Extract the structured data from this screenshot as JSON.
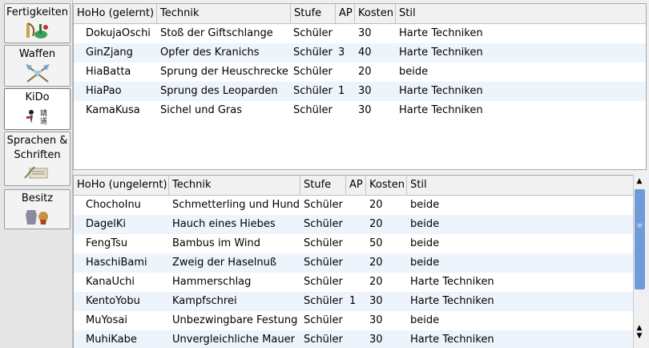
{
  "sidebar": {
    "tabs": [
      {
        "label": "Fertigkeiten",
        "icon": "instruments-icon",
        "active": false
      },
      {
        "label": "Waffen",
        "icon": "crossed-axes-icon",
        "active": false
      },
      {
        "label": "KiDo",
        "icon": "kido-scroll-icon",
        "active": true
      },
      {
        "label": "Sprachen & Schriften",
        "icon": "scroll-quill-icon",
        "active": false
      },
      {
        "label": "Besitz",
        "icon": "armor-icon",
        "active": false
      }
    ]
  },
  "learned": {
    "columns": [
      "HoHo (gelernt)",
      "Technik",
      "Stufe",
      "AP",
      "Kosten",
      "Stil"
    ],
    "rows": [
      [
        "DokujaOschi",
        "Stoß der Giftschlange",
        "Schüler",
        "",
        "30",
        "Harte Techniken"
      ],
      [
        "GinZjang",
        "Opfer des Kranichs",
        "Schüler",
        "3",
        "40",
        "Harte Techniken"
      ],
      [
        "HiaBatta",
        "Sprung der Heuschrecke",
        "Schüler",
        "",
        "20",
        "beide"
      ],
      [
        "HiaPao",
        "Sprung des Leoparden",
        "Schüler",
        "1",
        "30",
        "Harte Techniken"
      ],
      [
        "KamaKusa",
        "Sichel und Gras",
        "Schüler",
        "",
        "30",
        "Harte Techniken"
      ]
    ]
  },
  "unlearned": {
    "columns": [
      "HoHo (ungelernt)",
      "Technik",
      "Stufe",
      "AP",
      "Kosten",
      "Stil"
    ],
    "rows": [
      [
        "ChochoInu",
        "Schmetterling und Hund",
        "Schüler",
        "",
        "20",
        "beide"
      ],
      [
        "DagelKi",
        "Hauch eines Hiebes",
        "Schüler",
        "",
        "20",
        "beide"
      ],
      [
        "FengTsu",
        "Bambus im Wind",
        "Schüler",
        "",
        "50",
        "beide"
      ],
      [
        "HaschiBami",
        "Zweig der Haselnuß",
        "Schüler",
        "",
        "20",
        "beide"
      ],
      [
        "KanaUchi",
        "Hammerschlag",
        "Schüler",
        "",
        "20",
        "Harte Techniken"
      ],
      [
        "KentoYobu",
        "Kampfschrei",
        "Schüler",
        "1",
        "30",
        "Harte Techniken"
      ],
      [
        "MuYosai",
        "Unbezwingbare Festung",
        "Schüler",
        "",
        "30",
        "beide"
      ],
      [
        "MuhiKabe",
        "Unvergleichliche Mauer",
        "Schüler",
        "",
        "30",
        "Harte Techniken"
      ]
    ]
  },
  "scrollbar": {
    "grip": "≡",
    "up": "▲",
    "down": "▲▼"
  }
}
